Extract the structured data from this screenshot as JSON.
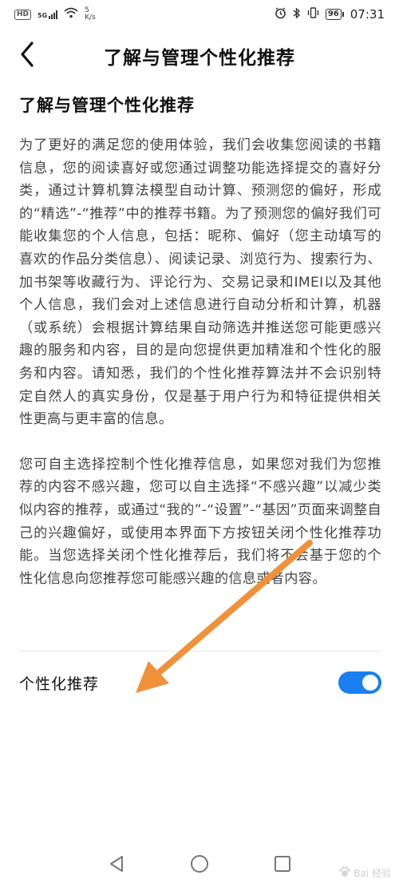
{
  "status_bar": {
    "hd": "HD",
    "network": "5G",
    "speed_value": "5",
    "speed_unit": "K/s",
    "battery": "96",
    "time": "07:31"
  },
  "header": {
    "title": "了解与管理个性化推荐"
  },
  "main": {
    "section_title": "了解与管理个性化推荐",
    "paragraphs": [
      "为了更好的满足您的使用体验，我们会收集您阅读的书籍信息，您的阅读喜好或您通过调整功能选择提交的喜好分类，通过计算机算法模型自动计算、预测您的偏好，形成的“精选”-“推荐”中的推荐书籍。为了预测您的偏好我们可能收集您的个人信息，包括：昵称、偏好（您主动填写的喜欢的作品分类信息）、阅读记录、浏览行为、搜索行为、加书架等收藏行为、评论行为、交易记录和IMEI以及其他个人信息，我们会对上述信息进行自动分析和计算，机器（或系统）会根据计算结果自动筛选并推送您可能更感兴趣的服务和内容，目的是向您提供更加精准和个性化的服务和内容。请知悉，我们的个性化推荐算法并不会识别特定自然人的真实身份，仅是基于用户行为和特征提供相关性更高与更丰富的信息。",
      "您可自主选择控制个性化推荐信息，如果您对我们为您推荐的内容不感兴趣，您可以自主选择“不感兴趣”以减少类似内容的推荐，或通过“我的”-“设置”-“基因”页面来调整自己的兴趣偏好，或使用本界面下方按钮关闭个性化推荐功能。当您选择关闭个性化推荐后，我们将不会基于您的个性化信息向您推荐您可能感兴趣的信息或者内容。"
    ],
    "toggle_label": "个性化推荐",
    "toggle_on": true
  },
  "watermark": "Bai 经验",
  "colors": {
    "accent": "#1a7ff0",
    "arrow": "#f0913a",
    "text": "#444444"
  }
}
